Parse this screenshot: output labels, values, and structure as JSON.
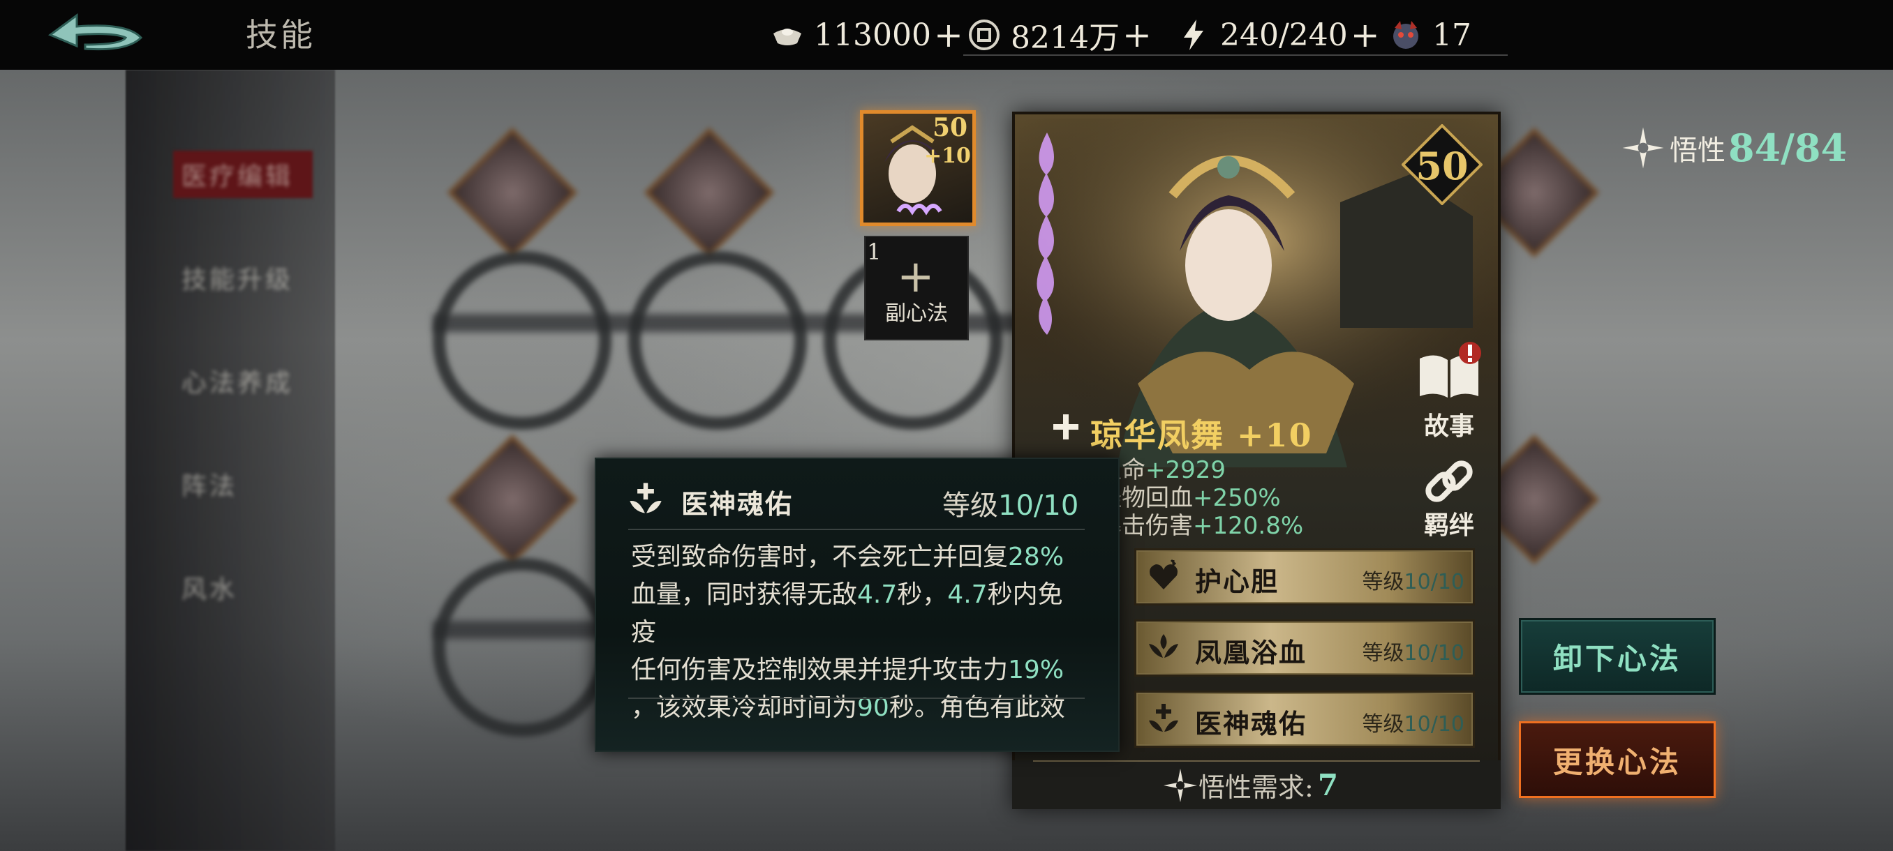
{
  "header": {
    "title": "技能",
    "resources": [
      {
        "icon": "silver-ingot-icon",
        "value": "113000"
      },
      {
        "icon": "coin-icon",
        "value": "8214万"
      },
      {
        "icon": "lightning-icon",
        "value": "240/240"
      },
      {
        "icon": "demon-mask-icon",
        "value": "17"
      }
    ]
  },
  "mini_portrait": {
    "level": "50",
    "bonus": "+10"
  },
  "sub_skill": {
    "count": "1",
    "label": "副心法"
  },
  "hero": {
    "level": "50",
    "name": "琼华凤舞 +10",
    "stats": [
      {
        "label": "角色生命",
        "value": "+2929"
      },
      {
        "label": "击倒怪物回血",
        "value": "+250%"
      },
      {
        "label": "技能暴击伤害",
        "value": "+120.8%"
      }
    ]
  },
  "side_buttons": [
    {
      "label": "故事",
      "icon": "book-icon"
    },
    {
      "label": "羁绊",
      "icon": "link-icon"
    }
  ],
  "skills": [
    {
      "name": "护心胆",
      "level_label": "等级",
      "level": "10/10",
      "icon": "heart-shield-icon"
    },
    {
      "name": "凤凰浴血",
      "level_label": "等级",
      "level": "10/10",
      "icon": "phoenix-icon"
    },
    {
      "name": "医神魂佑",
      "level_label": "等级",
      "level": "10/10",
      "icon": "winged-cross-icon"
    }
  ],
  "requirement": {
    "label": "悟性需求:",
    "value": "7"
  },
  "insight": {
    "label": "悟性",
    "value": "84/84"
  },
  "buttons": {
    "unequip": "卸下心法",
    "change": "更换心法"
  },
  "tooltip": {
    "name": "医神魂佑",
    "level_label": "等级",
    "level": "10/10",
    "desc": [
      {
        "t": "受到致命伤害时，不会死亡并回复",
        "g": "28%"
      },
      {
        "t": "血量，同时获得无敌",
        "g": "4.7"
      },
      {
        "t": "秒，",
        "g": "4.7"
      },
      {
        "t": "秒内免疫",
        "g": ""
      },
      {
        "t": "任何伤害及控制效果并提升攻击力",
        "g": "19%"
      },
      {
        "t": "，该效果冷却时间为",
        "g": "90"
      },
      {
        "t": "秒。角色有此效",
        "g": ""
      }
    ]
  },
  "sidebar_blurred": [
    "医疗编辑",
    "技能升级",
    "心法养成",
    "阵法",
    "风水"
  ],
  "colors": {
    "accent_green": "#8fe0c2",
    "gold": "#f2cf62",
    "orange": "#f07020"
  }
}
